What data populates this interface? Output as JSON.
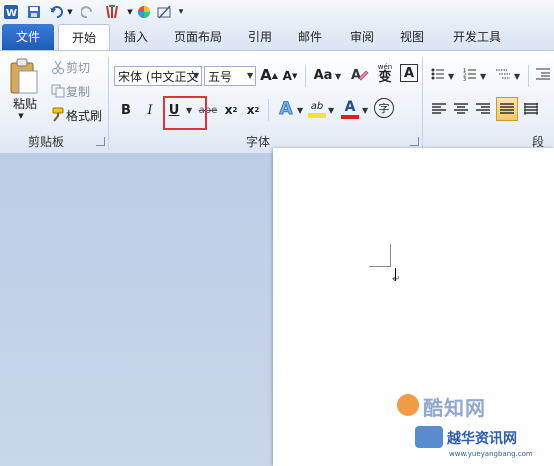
{
  "tabs": {
    "file": "文件",
    "home": "开始",
    "insert": "插入",
    "layout": "页面布局",
    "references": "引用",
    "mailings": "邮件",
    "review": "审阅",
    "view": "视图",
    "developer": "开发工具"
  },
  "clipboard": {
    "paste": "粘贴",
    "cut": "剪切",
    "copy": "复制",
    "format_painter": "格式刷",
    "group_label": "剪贴板"
  },
  "font": {
    "font_name": "宋体 (中文正文",
    "font_size": "五号",
    "grow": "A",
    "shrink": "A",
    "change_case": "Aa",
    "clear_format": "A",
    "phonetic": "wén",
    "phonetic_char": "变",
    "border_char": "A",
    "bold": "B",
    "italic": "I",
    "underline": "U",
    "strikethrough": "abe",
    "subscript": "x",
    "superscript": "x",
    "text_effect": "A",
    "highlight": "ab",
    "font_color": "A",
    "enclose_char": "字",
    "group_label": "字体"
  },
  "paragraph": {
    "group_label": "段落"
  },
  "watermark": {
    "brand_top": "酷知网",
    "brand_bottom": "越华资讯网",
    "url": "www.yueyangbang.com"
  },
  "colors": {
    "highlight_box": "#e2323c",
    "file_tab": "#2a67c4",
    "font_color_bar": "#e02020",
    "highlight_bar": "#f3e52a"
  }
}
